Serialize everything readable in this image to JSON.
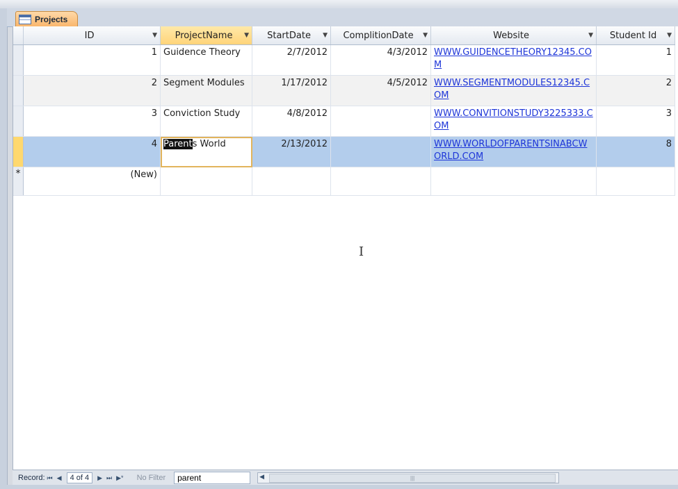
{
  "tab": {
    "label": "Projects"
  },
  "columns": [
    {
      "key": "id",
      "label": "ID"
    },
    {
      "key": "project_name",
      "label": "ProjectName"
    },
    {
      "key": "start_date",
      "label": "StartDate"
    },
    {
      "key": "completion_date",
      "label": "ComplitionDate"
    },
    {
      "key": "website",
      "label": "Website"
    },
    {
      "key": "student_id",
      "label": "Student Id"
    }
  ],
  "rows": [
    {
      "id": "1",
      "project_name": "Guidence Theory",
      "start_date": "2/7/2012",
      "completion_date": "4/3/2012",
      "website": "WWW.GUIDENCETHEORY12345.COM",
      "student_id": "1"
    },
    {
      "id": "2",
      "project_name": "Segment Modules",
      "start_date": "1/17/2012",
      "completion_date": "4/5/2012",
      "website": "WWW.SEGMENTMODULES12345.COM",
      "student_id": "2"
    },
    {
      "id": "3",
      "project_name": "Conviction Study",
      "start_date": "4/8/2012",
      "completion_date": "",
      "website": "WWW.CONVITIONSTUDY3225333.COM",
      "student_id": "3"
    },
    {
      "id": "4",
      "project_name_highlight": "Parent",
      "project_name_rest": "s World",
      "start_date": "2/13/2012",
      "completion_date": "",
      "website": "WWW.WORLDOFPARENTSINABCWORLD.COM",
      "student_id": "8"
    }
  ],
  "new_row": {
    "marker": "*",
    "label": "(New)"
  },
  "status": {
    "record_label": "Record:",
    "first": "⏮",
    "prev": "◀",
    "position": "4 of 4",
    "next": "▶",
    "last": "⏭",
    "new": "▶*",
    "filter_label": "No Filter",
    "search_value": "parent"
  },
  "colors": {
    "selected_header": "#ffd47a",
    "current_row": "#b3cdec",
    "link": "#1d35d8"
  }
}
